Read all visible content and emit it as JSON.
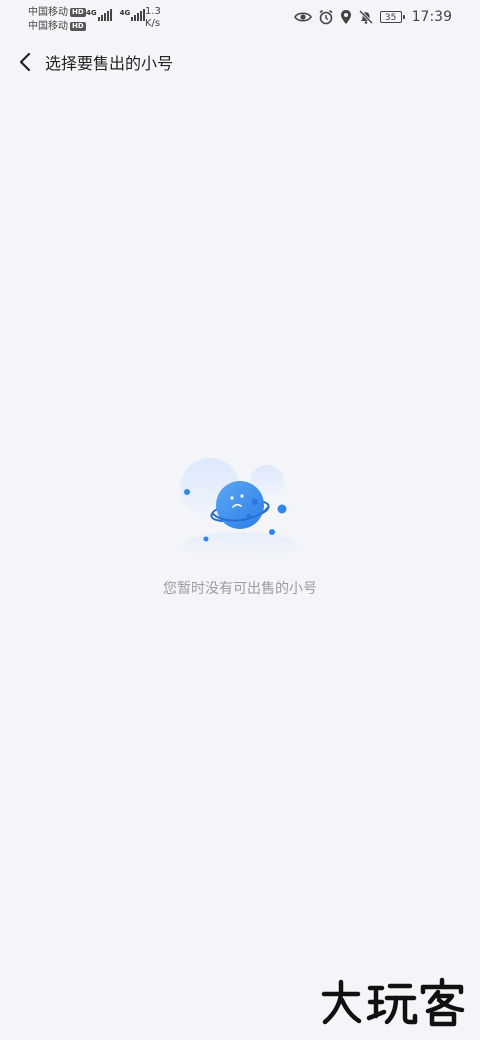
{
  "status_bar": {
    "carrier_1": "中国移动",
    "carrier_2": "中国移动",
    "hd_badge": "HD",
    "network_1": "4G",
    "network_2": "4G",
    "speed_value": "1.3",
    "speed_unit": "K/s",
    "battery": "35",
    "time": "17:39"
  },
  "header": {
    "title": "选择要售出的小号"
  },
  "empty_state": {
    "message": "您暂时没有可出售的小号"
  },
  "watermark": {
    "text": "大玩客"
  },
  "colors": {
    "background": "#f4f5f8",
    "planet": "#3b8cf0",
    "accent_dot": "#2f86ee"
  },
  "icons": [
    "back-arrow-icon",
    "eye-icon",
    "alarm-icon",
    "location-icon",
    "mute-bell-icon"
  ]
}
